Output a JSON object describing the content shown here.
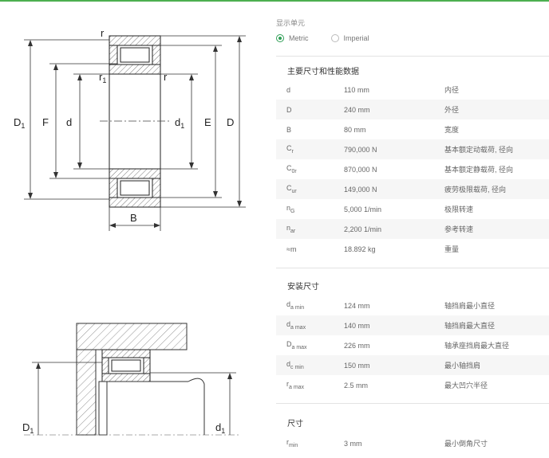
{
  "units": {
    "title": "显示单元",
    "options": [
      {
        "label": "Metric",
        "selected": true
      },
      {
        "label": "Imperial",
        "selected": false
      }
    ]
  },
  "drawing_labels": {
    "top": {
      "r_top": "r",
      "r1": "r",
      "r1_sub": "1",
      "r_right": "r",
      "D1": "D",
      "D1_sub": "1",
      "F": "F",
      "d": "d",
      "d1": "d",
      "d1_sub": "1",
      "E": "E",
      "D": "D",
      "B": "B"
    },
    "bottom": {
      "D1": "D",
      "D1_sub": "1",
      "d1": "d",
      "d1_sub": "1"
    }
  },
  "main_dims": {
    "title": "主要尺寸和性能数据",
    "rows": [
      {
        "sym": "d",
        "sub": "",
        "value": "110 mm",
        "desc": "内径"
      },
      {
        "sym": "D",
        "sub": "",
        "value": "240 mm",
        "desc": "外径"
      },
      {
        "sym": "B",
        "sub": "",
        "value": "80 mm",
        "desc": "宽度"
      },
      {
        "sym": "C",
        "sub": "r",
        "value": "790,000 N",
        "desc": "基本额定动载荷, 径向"
      },
      {
        "sym": "C",
        "sub": "0r",
        "value": "870,000 N",
        "desc": "基本额定静载荷, 径向"
      },
      {
        "sym": "C",
        "sub": "ur",
        "value": "149,000 N",
        "desc": "疲劳极限载荷, 径向"
      },
      {
        "sym": "n",
        "sub": "G",
        "value": "5,000 1/min",
        "desc": "极限转速"
      },
      {
        "sym": "n",
        "sub": "ar",
        "value": "2,200 1/min",
        "desc": "参考转速"
      },
      {
        "sym": "≈m",
        "sub": "",
        "value": "18.892 kg",
        "desc": "重量"
      }
    ]
  },
  "mounting": {
    "title": "安装尺寸",
    "rows": [
      {
        "sym": "d",
        "sub": "a min",
        "value": "124 mm",
        "desc": "轴挡肩最小直径"
      },
      {
        "sym": "d",
        "sub": "a max",
        "value": "140 mm",
        "desc": "轴挡肩最大直径"
      },
      {
        "sym": "D",
        "sub": "a max",
        "value": "226 mm",
        "desc": "轴承座挡肩最大直径"
      },
      {
        "sym": "d",
        "sub": "c min",
        "value": "150 mm",
        "desc": "最小轴挡肩"
      },
      {
        "sym": "r",
        "sub": "a max",
        "value": "2.5 mm",
        "desc": "最大凹穴半径"
      }
    ]
  },
  "dims": {
    "title": "尺寸",
    "rows": [
      {
        "sym": "r",
        "sub": "min",
        "value": "3 mm",
        "desc": "最小倒角尺寸"
      }
    ]
  }
}
